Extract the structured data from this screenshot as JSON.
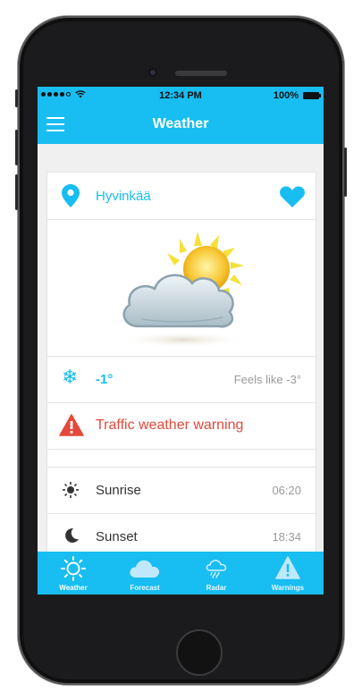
{
  "status_bar": {
    "time": "12:34 PM",
    "battery": "100%"
  },
  "nav": {
    "title": "Weather"
  },
  "location": {
    "name": "Hyvinkää"
  },
  "current": {
    "temperature": "-1°",
    "feels_like": "Feels like -3°"
  },
  "warning": {
    "text": "Traffic weather warning"
  },
  "sun": {
    "sunrise_label": "Sunrise",
    "sunrise_time": "06:20",
    "sunset_label": "Sunset",
    "sunset_time": "18:34"
  },
  "tabs": [
    {
      "label": "Weather",
      "icon": "sun-icon",
      "active": true
    },
    {
      "label": "Forecast",
      "icon": "cloud-icon",
      "active": false
    },
    {
      "label": "Radar",
      "icon": "rain-cloud-icon",
      "active": false
    },
    {
      "label": "Warnings",
      "icon": "warning-triangle-icon",
      "active": false
    }
  ],
  "colors": {
    "accent": "#18bdf1",
    "warning": "#e5483a"
  }
}
